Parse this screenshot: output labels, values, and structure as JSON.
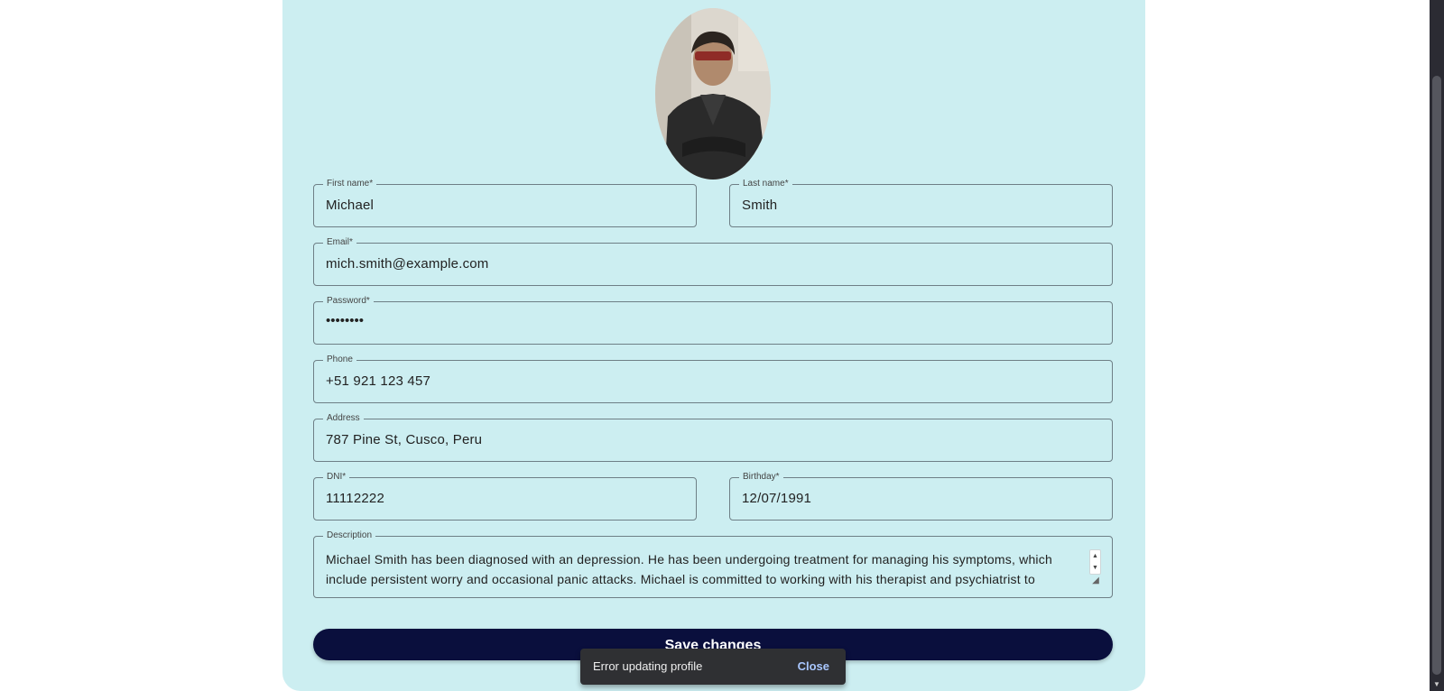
{
  "form": {
    "first_name": {
      "label": "First name*",
      "value": "Michael"
    },
    "last_name": {
      "label": "Last name*",
      "value": "Smith"
    },
    "email": {
      "label": "Email*",
      "value": "mich.smith@example.com"
    },
    "password": {
      "label": "Password*",
      "value": "••••••••"
    },
    "phone": {
      "label": "Phone",
      "value": "+51 921 123 457"
    },
    "address": {
      "label": "Address",
      "value": "787 Pine St, Cusco, Peru"
    },
    "dni": {
      "label": "DNI*",
      "value": "11112222"
    },
    "birthday": {
      "label": "Birthday*",
      "value": "12/07/1991"
    },
    "description": {
      "label": "Description",
      "value": "Michael Smith has been diagnosed with an depression. He has been undergoing treatment for managing his symptoms, which include persistent worry and occasional panic attacks. Michael is committed to working with his therapist and psychiatrist to"
    },
    "save_label": "Save changes"
  },
  "snackbar": {
    "message": "Error updating profile",
    "close_label": "Close"
  },
  "colors": {
    "card_bg": "#cceef1",
    "button_bg": "#0a0f3d",
    "snackbar_bg": "#2f3033",
    "snackbar_action": "#a9c7ff"
  }
}
